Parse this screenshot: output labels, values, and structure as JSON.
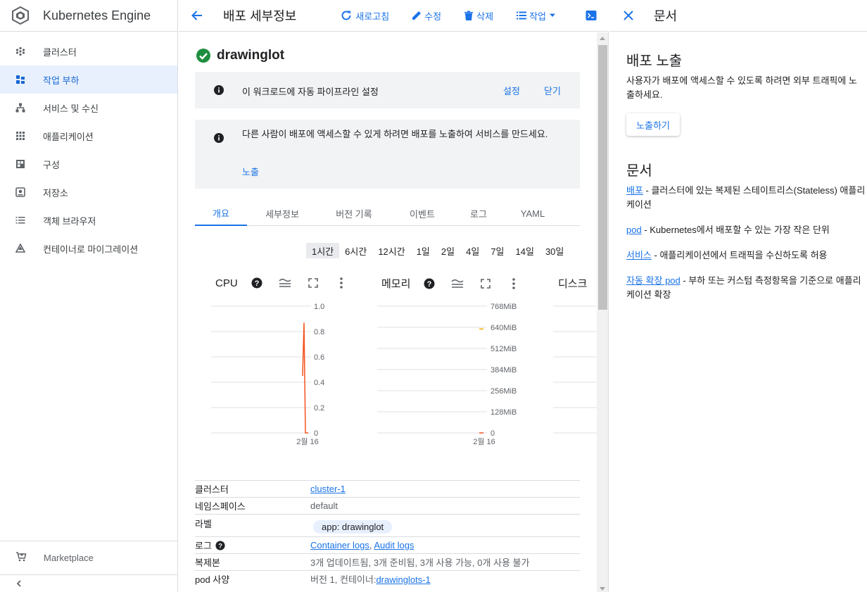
{
  "brand": {
    "title": "Kubernetes Engine"
  },
  "sidebar": {
    "items": [
      {
        "label": "클러스터",
        "icon": "cluster-icon"
      },
      {
        "label": "작업 부하",
        "icon": "workloads-icon",
        "active": true
      },
      {
        "label": "서비스 및 수신",
        "icon": "services-icon"
      },
      {
        "label": "애플리케이션",
        "icon": "apps-icon"
      },
      {
        "label": "구성",
        "icon": "config-icon"
      },
      {
        "label": "저장소",
        "icon": "storage-icon"
      },
      {
        "label": "객체 브라우저",
        "icon": "object-browser-icon"
      },
      {
        "label": "컨테이너로 마이그레이션",
        "icon": "migrate-icon"
      }
    ],
    "marketplace": "Marketplace"
  },
  "toolbar": {
    "title": "배포 세부정보",
    "refresh": "새로고침",
    "edit": "수정",
    "delete": "삭제",
    "actions": "작업"
  },
  "deployment": {
    "name": "drawinglot",
    "status_color": "#1e8e3e"
  },
  "banner1": {
    "text": "이 워크로드에 자동 파이프라인 설정",
    "link1": "설정",
    "link2": "닫기"
  },
  "banner2": {
    "text": "다른 사람이 배포에 액세스할 수 있게 하려면 배포를 노출하여 서비스를 만드세요.",
    "link": "노출"
  },
  "tabs": [
    "개요",
    "세부정보",
    "버전 기록",
    "이벤트",
    "로그",
    "YAML"
  ],
  "ranges": [
    "1시간",
    "6시간",
    "12시간",
    "1일",
    "2일",
    "4일",
    "7일",
    "14일",
    "30일"
  ],
  "charts": {
    "cpu": {
      "title": "CPU",
      "ticks": [
        "1.0",
        "0.8",
        "0.6",
        "0.4",
        "0.2",
        "0"
      ],
      "xlabel": "2월 16"
    },
    "memory": {
      "title": "메모리",
      "ticks": [
        "768MiB",
        "640MiB",
        "512MiB",
        "384MiB",
        "256MiB",
        "128MiB",
        "0"
      ],
      "xlabel": "2월 16"
    },
    "disk": {
      "title": "디스크"
    }
  },
  "chart_data": [
    {
      "type": "line",
      "title": "CPU",
      "ylim": [
        0,
        1.0
      ],
      "x": [
        "2월 16"
      ],
      "series": [
        {
          "values": [
            0.45,
            0.87,
            0.0,
            0.0
          ]
        }
      ]
    },
    {
      "type": "line",
      "title": "메모리",
      "ylim": [
        0,
        768
      ],
      "x": [
        "2월 16"
      ],
      "series": [
        {
          "values": [
            0,
            0
          ]
        },
        {
          "values": [
            630,
            630
          ]
        }
      ]
    }
  ],
  "details": {
    "cluster_label": "클러스터",
    "cluster_value": "cluster-1",
    "namespace_label": "네임스페이스",
    "namespace_value": "default",
    "labels_label": "라벨",
    "labels_value": "app: drawinglot",
    "logs_label": "로그",
    "logs_container": "Container logs",
    "logs_audit": "Audit logs",
    "replicas_label": "복제본",
    "replicas_value": "3개 업데이트됨, 3개 준비됨, 3개 사용 가능, 0개 사용 불가",
    "pod_label": "pod 사양",
    "pod_value": "버전 1, 컨테이너:",
    "pod_link": "drawinglots-1"
  },
  "right_panel": {
    "title": "문서",
    "expose_heading": "배포 노출",
    "expose_text_1": "사용자가 배포에 액세스할 수 있도록 하려면 외부 트래픽에 노",
    "expose_text_2": "출하세요.",
    "expose_button": "노출하기",
    "docs_heading": "문서",
    "docs": [
      {
        "link": "배포",
        "text": " - 클러스터에 있는 복제된 스테이트리스(Stateless) 애플리",
        "text2": "케이션"
      },
      {
        "link": "pod",
        "text": " - Kubernetes에서 배포할 수 있는 가장 작은 단위"
      },
      {
        "link": "서비스",
        "text": " - 애플리케이션에서 트래픽을 수신하도록 허용"
      },
      {
        "link": "자동 확장 pod",
        "text": " - 부하 또는 커스텀 측정항목을 기준으로 애플리",
        "text2": "케이션 확장"
      }
    ]
  }
}
